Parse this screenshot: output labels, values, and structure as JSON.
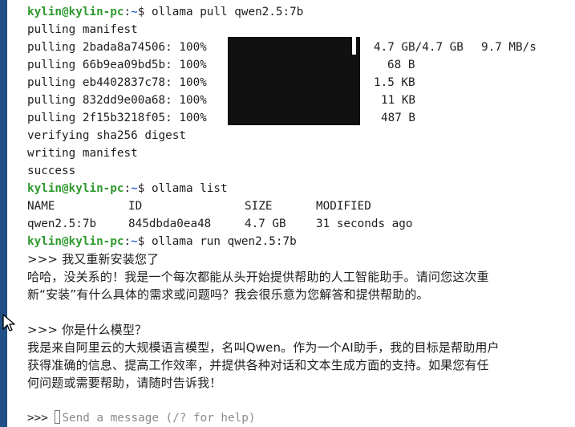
{
  "prompt": {
    "user": "kylin@kylin-pc",
    "sep": ":",
    "path": "~",
    "sym": "$"
  },
  "cmd_pull": " ollama pull qwen2.5:7b",
  "pulling_manifest": "pulling manifest",
  "layers": [
    {
      "label": "pulling 2bada8a74506: 100%",
      "size": "4.7 GB/4.7 GB",
      "rate": "9.7 MB/s",
      "progress": 1.0
    },
    {
      "label": "pulling 66b9ea09bd5b: 100%",
      "size": "68 B",
      "progress": 1.0
    },
    {
      "label": "pulling eb4402837c78: 100%",
      "size": "1.5 KB",
      "progress": 1.0
    },
    {
      "label": "pulling 832dd9e00a68: 100%",
      "size": "11 KB",
      "progress": 1.0
    },
    {
      "label": "pulling 2f15b3218f05: 100%",
      "size": "487 B",
      "progress": 1.0
    }
  ],
  "verifying": "verifying sha256 digest",
  "writing": "writing manifest",
  "success": "success",
  "cmd_list": " ollama list",
  "list": {
    "headers": {
      "name": "NAME",
      "id": "ID",
      "size": "SIZE",
      "modified": "MODIFIED"
    },
    "rows": [
      {
        "name": "qwen2.5:7b",
        "id": "845dbda0ea48",
        "size": "4.7 GB",
        "modified": "31 seconds ago"
      }
    ]
  },
  "cmd_run": " ollama run qwen2.5:7b",
  "chat": {
    "q1": ">>> 我又重新安装您了",
    "a1_l1": "哈哈，没关系的！我是一个每次都能从头开始提供帮助的人工智能助手。请问您这次重",
    "a1_l2": "新“安装”有什么具体的需求或问题吗？我会很乐意为您解答和提供帮助的。",
    "q2": ">>> 你是什么模型？",
    "a2_l1": "我是来自阿里云的大规模语言模型，名叫Qwen。作为一个AI助手，我的目标是帮助用户",
    "a2_l2": "获得准确的信息、提高工作效率，并提供各种对话和文本生成方面的支持。如果您有任",
    "a2_l3": "何问题或需要帮助，请随时告诉我！"
  },
  "input": {
    "prompt": ">>> ",
    "placeholder": "Send a message (/? for help)"
  },
  "colors": {
    "user": "#2e9a2e",
    "path": "#3b6fd1",
    "bar": "#111111",
    "strip": "#1f4f86"
  },
  "icons": {
    "pointer": "mouse-pointer-icon"
  }
}
